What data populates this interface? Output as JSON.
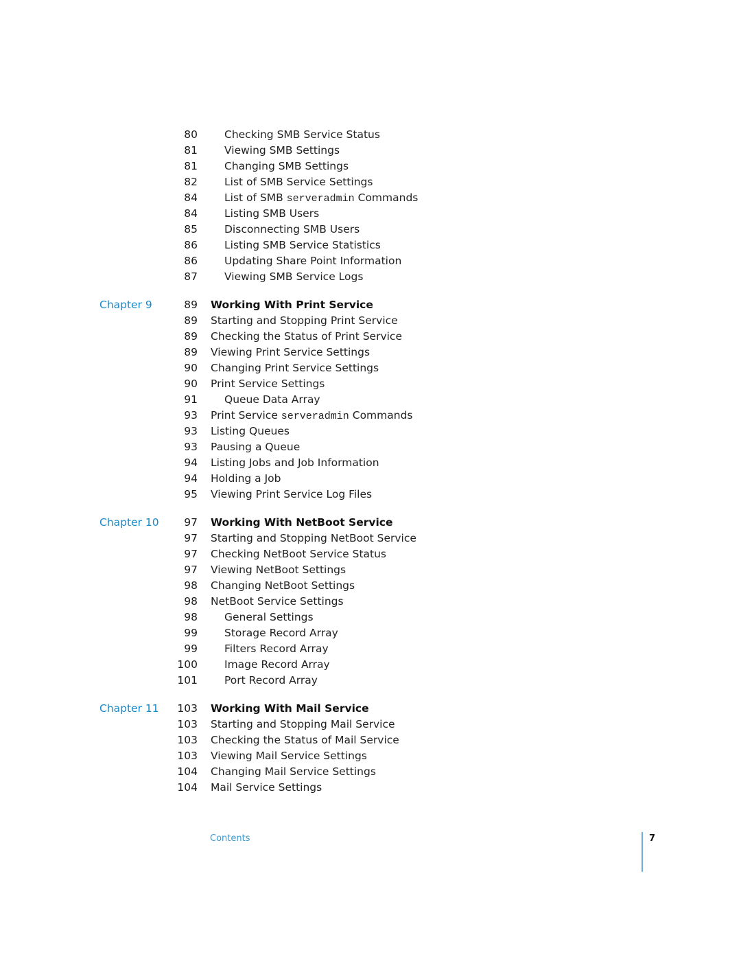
{
  "sections": [
    {
      "chapter": null,
      "entries": [
        {
          "page": "80",
          "title": "Checking SMB Service Status",
          "level": 2
        },
        {
          "page": "81",
          "title": "Viewing SMB Settings",
          "level": 2
        },
        {
          "page": "81",
          "title": "Changing SMB Settings",
          "level": 2
        },
        {
          "page": "82",
          "title": "List of SMB Service Settings",
          "level": 2
        },
        {
          "page": "84",
          "title_parts": [
            "List of SMB ",
            "serveradmin",
            " Commands"
          ],
          "level": 2
        },
        {
          "page": "84",
          "title": "Listing SMB Users",
          "level": 2
        },
        {
          "page": "85",
          "title": "Disconnecting SMB Users",
          "level": 2
        },
        {
          "page": "86",
          "title": "Listing SMB Service Statistics",
          "level": 2
        },
        {
          "page": "86",
          "title": "Updating Share Point Information",
          "level": 2
        },
        {
          "page": "87",
          "title": "Viewing SMB Service Logs",
          "level": 2
        }
      ]
    },
    {
      "chapter": "Chapter 9",
      "entries": [
        {
          "page": "89",
          "title": "Working With Print Service",
          "level": 0
        },
        {
          "page": "89",
          "title": "Starting and Stopping Print Service",
          "level": 1
        },
        {
          "page": "89",
          "title": "Checking the Status of Print Service",
          "level": 1
        },
        {
          "page": "89",
          "title": "Viewing Print Service Settings",
          "level": 1
        },
        {
          "page": "90",
          "title": "Changing Print Service Settings",
          "level": 1
        },
        {
          "page": "90",
          "title": "Print Service Settings",
          "level": 1
        },
        {
          "page": "91",
          "title": "Queue Data Array",
          "level": 2
        },
        {
          "page": "93",
          "title_parts": [
            "Print Service ",
            "serveradmin",
            " Commands"
          ],
          "level": 1
        },
        {
          "page": "93",
          "title": "Listing Queues",
          "level": 1
        },
        {
          "page": "93",
          "title": "Pausing a Queue",
          "level": 1
        },
        {
          "page": "94",
          "title": "Listing Jobs and Job Information",
          "level": 1
        },
        {
          "page": "94",
          "title": "Holding a Job",
          "level": 1
        },
        {
          "page": "95",
          "title": "Viewing Print Service Log Files",
          "level": 1
        }
      ]
    },
    {
      "chapter": "Chapter 10",
      "entries": [
        {
          "page": "97",
          "title": "Working With NetBoot Service",
          "level": 0
        },
        {
          "page": "97",
          "title": "Starting and Stopping NetBoot Service",
          "level": 1
        },
        {
          "page": "97",
          "title": "Checking NetBoot Service Status",
          "level": 1
        },
        {
          "page": "97",
          "title": "Viewing NetBoot Settings",
          "level": 1
        },
        {
          "page": "98",
          "title": "Changing NetBoot Settings",
          "level": 1
        },
        {
          "page": "98",
          "title": "NetBoot Service Settings",
          "level": 1
        },
        {
          "page": "98",
          "title": "General Settings",
          "level": 2
        },
        {
          "page": "99",
          "title": "Storage Record Array",
          "level": 2
        },
        {
          "page": "99",
          "title": "Filters Record Array",
          "level": 2
        },
        {
          "page": "100",
          "title": "Image Record Array",
          "level": 2
        },
        {
          "page": "101",
          "title": "Port Record Array",
          "level": 2
        }
      ]
    },
    {
      "chapter": "Chapter 11",
      "entries": [
        {
          "page": "103",
          "title": "Working With Mail Service",
          "level": 0
        },
        {
          "page": "103",
          "title": "Starting and Stopping Mail Service",
          "level": 1
        },
        {
          "page": "103",
          "title": "Checking the Status of Mail Service",
          "level": 1
        },
        {
          "page": "103",
          "title": "Viewing Mail Service Settings",
          "level": 1
        },
        {
          "page": "104",
          "title": "Changing Mail Service Settings",
          "level": 1
        },
        {
          "page": "104",
          "title": "Mail Service Settings",
          "level": 1
        }
      ]
    }
  ],
  "footer": {
    "section_label": "Contents",
    "page_number": "7"
  },
  "colors": {
    "accent": "#1a8ac8",
    "rule": "#6aaedb"
  }
}
